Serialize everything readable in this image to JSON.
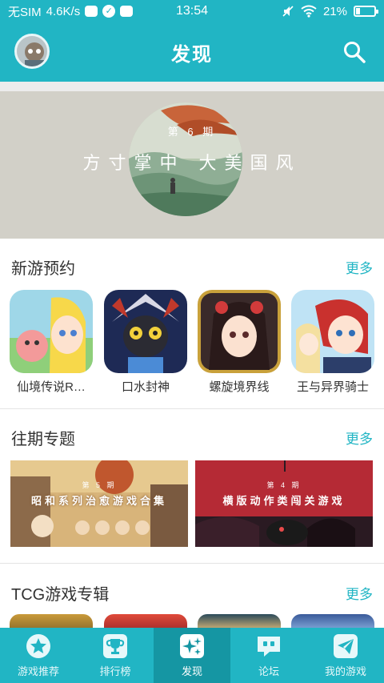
{
  "status_bar": {
    "carrier": "无SIM",
    "speed": "4.6K/s",
    "time": "13:54",
    "battery": "21%",
    "battery_level": 0.21
  },
  "header": {
    "title": "发现"
  },
  "banner": {
    "issue": "第 6 期",
    "title": "方寸掌中 大美国风"
  },
  "new_games": {
    "title": "新游预约",
    "more": "更多",
    "items": [
      {
        "name": "仙境传说R…",
        "icon": "ragnarok-game-icon"
      },
      {
        "name": "口水封神",
        "icon": "koushui-fengshen-game-icon"
      },
      {
        "name": "螺旋境界线",
        "icon": "luoxuan-jingjiexian-game-icon"
      },
      {
        "name": "王与异界骑士",
        "icon": "king-otherworld-knight-game-icon"
      }
    ]
  },
  "past_topics": {
    "title": "往期专题",
    "more": "更多",
    "items": [
      {
        "issue": "第 5 期",
        "title": "昭和系列治愈游戏合集"
      },
      {
        "issue": "第 4 期",
        "title": "横版动作类闯关游戏"
      }
    ]
  },
  "tcg": {
    "title": "TCG游戏专辑",
    "more": "更多"
  },
  "tabs": [
    {
      "label": "游戏推荐",
      "icon": "star-icon"
    },
    {
      "label": "排行榜",
      "icon": "trophy-icon"
    },
    {
      "label": "发现",
      "icon": "sparkle-icon",
      "active": true
    },
    {
      "label": "论坛",
      "icon": "chat-icon"
    },
    {
      "label": "我的游戏",
      "icon": "paper-plane-icon"
    }
  ],
  "colors": {
    "accent": "#21b5c4",
    "accent_dark": "#1596a3"
  }
}
